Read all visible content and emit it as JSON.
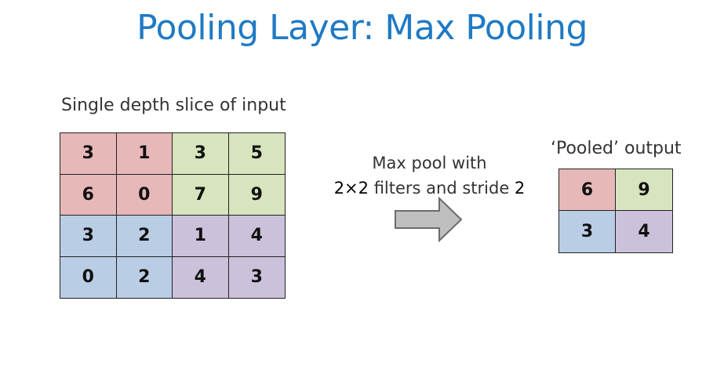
{
  "title": "Pooling Layer: Max Pooling",
  "input_caption": "Single depth slice of input",
  "operation": {
    "line1": "Max pool with",
    "line2_prefix": "2×2",
    "line2_middle": " filters and stride ",
    "line2_suffix": "2"
  },
  "output_caption": "‘Pooled’ output",
  "colors": {
    "red": "#e6b8b7",
    "green": "#d7e4bd",
    "blue": "#b9cde5",
    "purple": "#ccc1da",
    "arrow_fill": "#bfbfbf",
    "arrow_stroke": "#6b6b6b"
  },
  "input_grid": [
    [
      {
        "v": "3",
        "c": "red"
      },
      {
        "v": "1",
        "c": "red"
      },
      {
        "v": "3",
        "c": "green"
      },
      {
        "v": "5",
        "c": "green"
      }
    ],
    [
      {
        "v": "6",
        "c": "red"
      },
      {
        "v": "0",
        "c": "red"
      },
      {
        "v": "7",
        "c": "green"
      },
      {
        "v": "9",
        "c": "green"
      }
    ],
    [
      {
        "v": "3",
        "c": "blue"
      },
      {
        "v": "2",
        "c": "blue"
      },
      {
        "v": "1",
        "c": "purple"
      },
      {
        "v": "4",
        "c": "purple"
      }
    ],
    [
      {
        "v": "0",
        "c": "blue"
      },
      {
        "v": "2",
        "c": "blue"
      },
      {
        "v": "4",
        "c": "purple"
      },
      {
        "v": "3",
        "c": "purple"
      }
    ]
  ],
  "output_grid": [
    [
      {
        "v": "6",
        "c": "red"
      },
      {
        "v": "9",
        "c": "green"
      }
    ],
    [
      {
        "v": "3",
        "c": "blue"
      },
      {
        "v": "4",
        "c": "purple"
      }
    ]
  ]
}
